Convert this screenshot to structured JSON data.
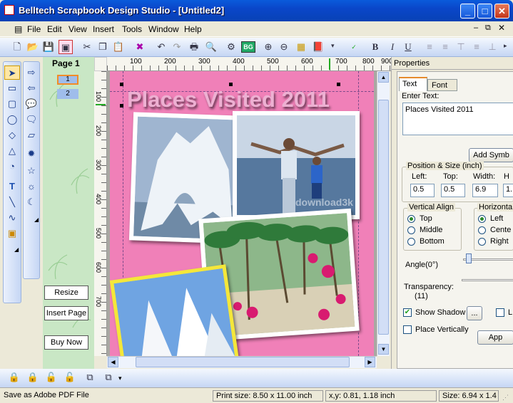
{
  "window": {
    "title": "Belltech Scrapbook Design Studio - [Untitled2]"
  },
  "menu": [
    "File",
    "Edit",
    "View",
    "Insert",
    "Tools",
    "Window",
    "Help"
  ],
  "toolbar": {
    "bg_label": "BG",
    "bold": "B",
    "italic": "I",
    "underline": "U"
  },
  "pages": {
    "title": "Page 1",
    "items": [
      "1",
      "2"
    ]
  },
  "left_buttons": {
    "resize": "Resize",
    "insert_page": "Insert Page",
    "buy_now": "Buy Now"
  },
  "ruler_top": [
    "100",
    "200",
    "300",
    "400",
    "500",
    "600",
    "700",
    "800",
    "900"
  ],
  "ruler_left": [
    "100",
    "200",
    "300",
    "400",
    "500",
    "600",
    "700"
  ],
  "canvas": {
    "headline": "Places Visited 2011",
    "watermark": "download3k"
  },
  "properties": {
    "title": "Properties",
    "tabs": [
      "Text",
      "Font"
    ],
    "enter_text_label": "Enter Text:",
    "text_value": "Places Visited 2011",
    "add_symbol": "Add Symb",
    "pos_size_legend": "Position & Size (inch)",
    "left_label": "Left:",
    "top_label": "Top:",
    "width_label": "Width:",
    "height_label": "H",
    "left_value": "0.5",
    "top_value": "0.5",
    "width_value": "6.9",
    "height_value": "1.",
    "valign_legend": "Vertical Align",
    "valign_options": [
      "Top",
      "Middle",
      "Bottom"
    ],
    "halign_legend": "Horizonta",
    "halign_options": [
      "Left",
      "Cente",
      "Right"
    ],
    "angle_label": "Angle(0°)",
    "transparency_label": "Transparency:",
    "transparency_value": "(11)",
    "show_shadow": "Show Shadow",
    "dots": "...",
    "l_label": "L",
    "place_vertically": "Place Vertically",
    "apply": "App"
  },
  "status": {
    "left": "Save as Adobe PDF File",
    "print_size": "Print size: 8.50 x 11.00 inch",
    "xy": "x,y: 0.81, 1.18 inch",
    "size": "Size: 6.94 x 1.4"
  },
  "colors": {
    "page_bg": "#F080B8",
    "title_bar": "#0A46C9"
  }
}
